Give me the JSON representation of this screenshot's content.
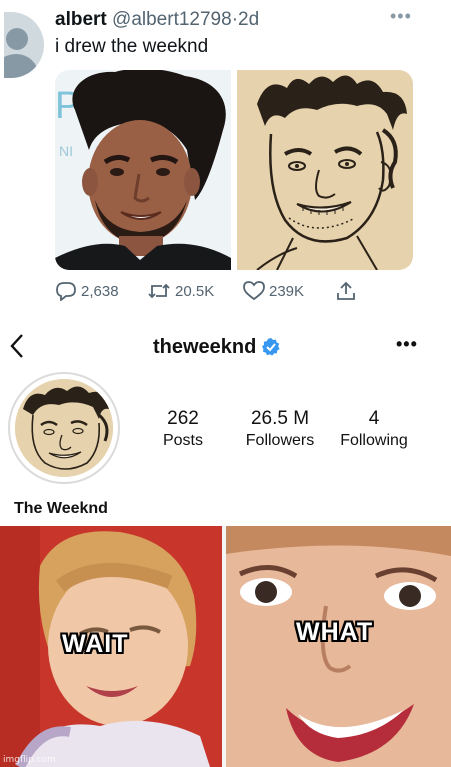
{
  "tweet": {
    "display_name": "albert",
    "handle": "@albert12798",
    "separator": "·",
    "age": "2d",
    "more_icon": "•••",
    "text": "i drew the weeknd",
    "media": [
      {
        "kind": "photo",
        "icon": "photo-image"
      },
      {
        "kind": "drawing",
        "icon": "pen-sketch-image"
      }
    ],
    "actions": {
      "replies": "2,638",
      "retweets": "20.5K",
      "likes": "239K"
    }
  },
  "instagram": {
    "username": "theweeknd",
    "verified_color": "#3897f0",
    "more_icon": "•••",
    "stats": [
      {
        "value": "262",
        "label": "Posts"
      },
      {
        "value": "26.5 M",
        "label": "Followers"
      },
      {
        "value": "4",
        "label": "Following"
      }
    ],
    "full_name": "The Weeknd"
  },
  "meme": {
    "left_caption": "WAIT",
    "right_caption": "WHAT",
    "watermark": "imgflip.com"
  },
  "colors": {
    "twitter_gray": "#536471",
    "meme_background": "#c0392b",
    "paper": "#e6d3ad"
  }
}
